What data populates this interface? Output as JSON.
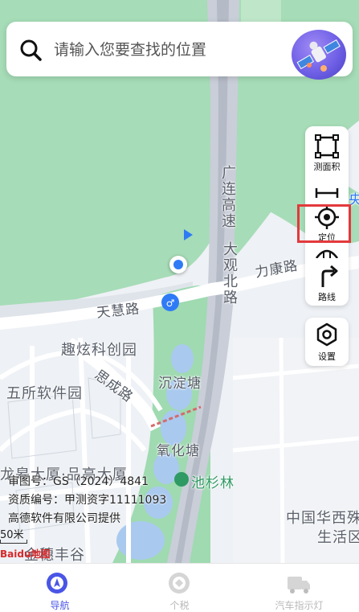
{
  "search": {
    "placeholder_text": "请输入您要查找的位置",
    "avatar_icon": "satellite-icon"
  },
  "tools": {
    "measure_area": "测面积",
    "locate": "定位",
    "route": "路线",
    "settings": "设置"
  },
  "map": {
    "roads": {
      "highway_vertical": "广连高速",
      "dagu_north": "大观北路",
      "likang": "力康路",
      "tianhui": "天慧路",
      "sicheng": "思成路"
    },
    "places": {
      "quxuan": "趣炫科创园",
      "wusuo": "五所软件园",
      "chendian": "沉淀塘",
      "yanghua": "氧化塘",
      "chishanlin": "池杉林",
      "longgao": "龙皋大厦·品高大厦",
      "zhongguo_huaxi": "中国华西殊",
      "shenghuoqu": "生活区",
      "jinsui": "金穗丰谷",
      "yang": "央"
    },
    "copyright": {
      "line1": "审图号：GS（2024）4841",
      "line2": "资质编号：甲测资字11111093",
      "line3": "高德软件有限公司提供"
    },
    "scale": "50米",
    "baidu_logo": "Baidu地图"
  },
  "bottom_nav": {
    "items": [
      {
        "label": "导航",
        "icon": "navigation-icon",
        "active": true
      },
      {
        "label": "个税",
        "icon": "tax-icon",
        "active": false
      },
      {
        "label": "汽车指示灯",
        "icon": "car-indicator-icon",
        "active": false
      }
    ]
  },
  "colors": {
    "accent": "#4a55e6",
    "highlight_box": "#e3393c",
    "park_green": "#8fd1a5",
    "water": "#a9c9ef",
    "location_blue": "#2f7bf6"
  }
}
